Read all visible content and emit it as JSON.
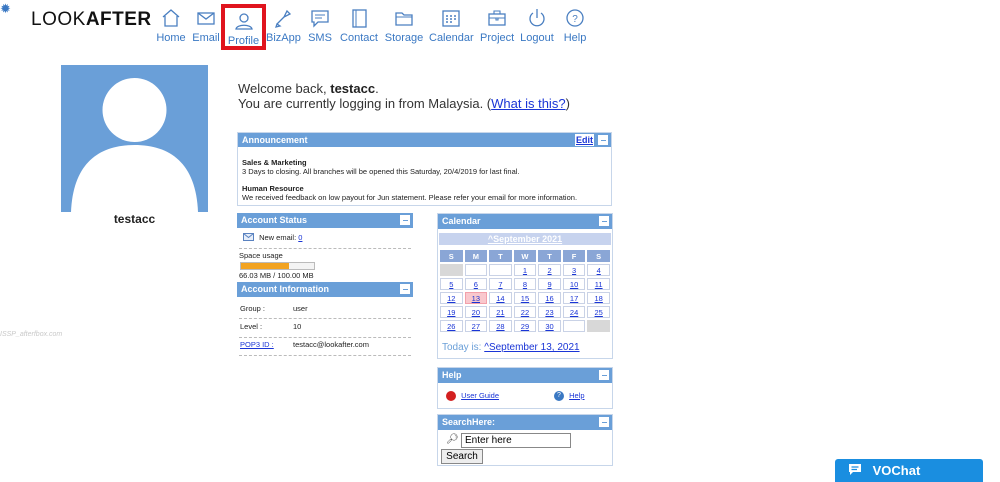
{
  "brand": {
    "logo_light": "LOOK",
    "logo_bold": "AFTER"
  },
  "nav": [
    {
      "label": "Home",
      "icon": "home-icon"
    },
    {
      "label": "Email",
      "icon": "email-icon"
    },
    {
      "label": "Profile",
      "icon": "profile-icon",
      "active": true
    },
    {
      "label": "BizApp",
      "icon": "bizapp-icon"
    },
    {
      "label": "SMS",
      "icon": "sms-icon"
    },
    {
      "label": "Contact",
      "icon": "contact-icon"
    },
    {
      "label": "Storage",
      "icon": "storage-icon"
    },
    {
      "label": "Calendar",
      "icon": "calendar-icon"
    },
    {
      "label": "Project",
      "icon": "project-icon"
    },
    {
      "label": "Logout",
      "icon": "logout-icon"
    },
    {
      "label": "Help",
      "icon": "help-icon"
    }
  ],
  "user": {
    "name": "testacc"
  },
  "watermark": "ISSP_afterfbox.com",
  "welcome": {
    "line1_prefix": "Welcome back, ",
    "username": "testacc",
    "line1_suffix": ".",
    "line2": "You are currently logging in from Malaysia. (",
    "link": "What is this?",
    "line2_end": ")"
  },
  "announcement": {
    "title": "Announcement",
    "edit": "Edit",
    "items": [
      {
        "heading": "Sales & Marketing",
        "text": "3 Days to closing. All branches will be opened this Saturday, 20/4/2019 for last final."
      },
      {
        "heading": "Human Resource",
        "text": "We received feedback on low payout for Jun statement. Please refer your email for more information."
      }
    ]
  },
  "account_status": {
    "title": "Account Status",
    "new_email_label": "New email:",
    "new_email_count": "0",
    "space_label": "Space usage",
    "space_used": "66.03 MB / 100.00 MB",
    "usage_fraction": 0.66
  },
  "account_info": {
    "title": "Account Information",
    "rows": [
      {
        "label": "Group :",
        "value": "user",
        "link": false
      },
      {
        "label": "Level :",
        "value": "10",
        "link": false
      },
      {
        "label": "POP3 ID :",
        "value": "testacc@lookafter.com",
        "link": true
      }
    ]
  },
  "calendar": {
    "title": "Calendar",
    "month": "^September 2021",
    "weekdays": [
      "S",
      "M",
      "T",
      "W",
      "T",
      "F",
      "S"
    ],
    "weeks": [
      [
        "",
        "",
        "",
        "1",
        "2",
        "3",
        "4"
      ],
      [
        "5",
        "6",
        "7",
        "8",
        "9",
        "10",
        "11"
      ],
      [
        "12",
        "13",
        "14",
        "15",
        "16",
        "17",
        "18"
      ],
      [
        "19",
        "20",
        "21",
        "22",
        "23",
        "24",
        "25"
      ],
      [
        "26",
        "27",
        "28",
        "29",
        "30",
        "",
        ""
      ]
    ],
    "today_label": "Today is:",
    "today_link": "^September 13, 2021",
    "today_day": "13"
  },
  "help": {
    "title": "Help",
    "user_guide": "User Guide",
    "help": "Help"
  },
  "search": {
    "title": "SearchHere:",
    "placeholder": "Enter here",
    "button": "Search"
  },
  "chat": {
    "label": "VOChat"
  }
}
